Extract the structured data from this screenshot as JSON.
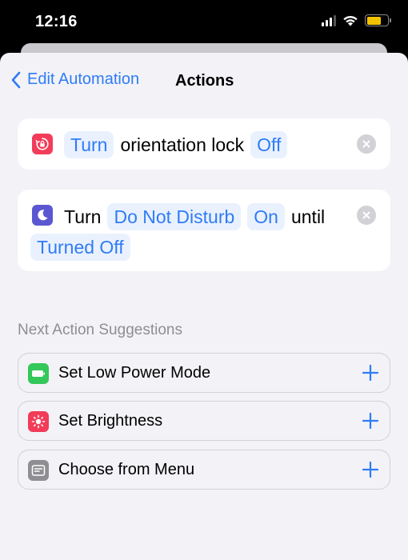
{
  "status_bar": {
    "time": "12:16"
  },
  "nav": {
    "back_label": "Edit Automation",
    "title": "Actions"
  },
  "actions": [
    {
      "icon": "orientation-lock-icon",
      "icon_color": "#f23c59",
      "tokens": [
        "Turn"
      ],
      "text1": "orientation lock",
      "value": "Off"
    },
    {
      "icon": "moon-icon",
      "icon_color": "#5b57d1",
      "verb": "Turn",
      "target": "Do Not Disturb",
      "state": "On",
      "conj": "until",
      "duration": "Turned Off"
    }
  ],
  "suggestions": {
    "header": "Next Action Suggestions",
    "items": [
      {
        "label": "Set Low Power Mode",
        "icon": "battery-icon",
        "icon_color": "#34c759"
      },
      {
        "label": "Set Brightness",
        "icon": "sun-icon",
        "icon_color": "#f23c59"
      },
      {
        "label": "Choose from Menu",
        "icon": "menu-icon",
        "icon_color": "#8e8e93"
      }
    ]
  },
  "colors": {
    "accent": "#2f7cf6",
    "background": "#f2f2f7"
  }
}
